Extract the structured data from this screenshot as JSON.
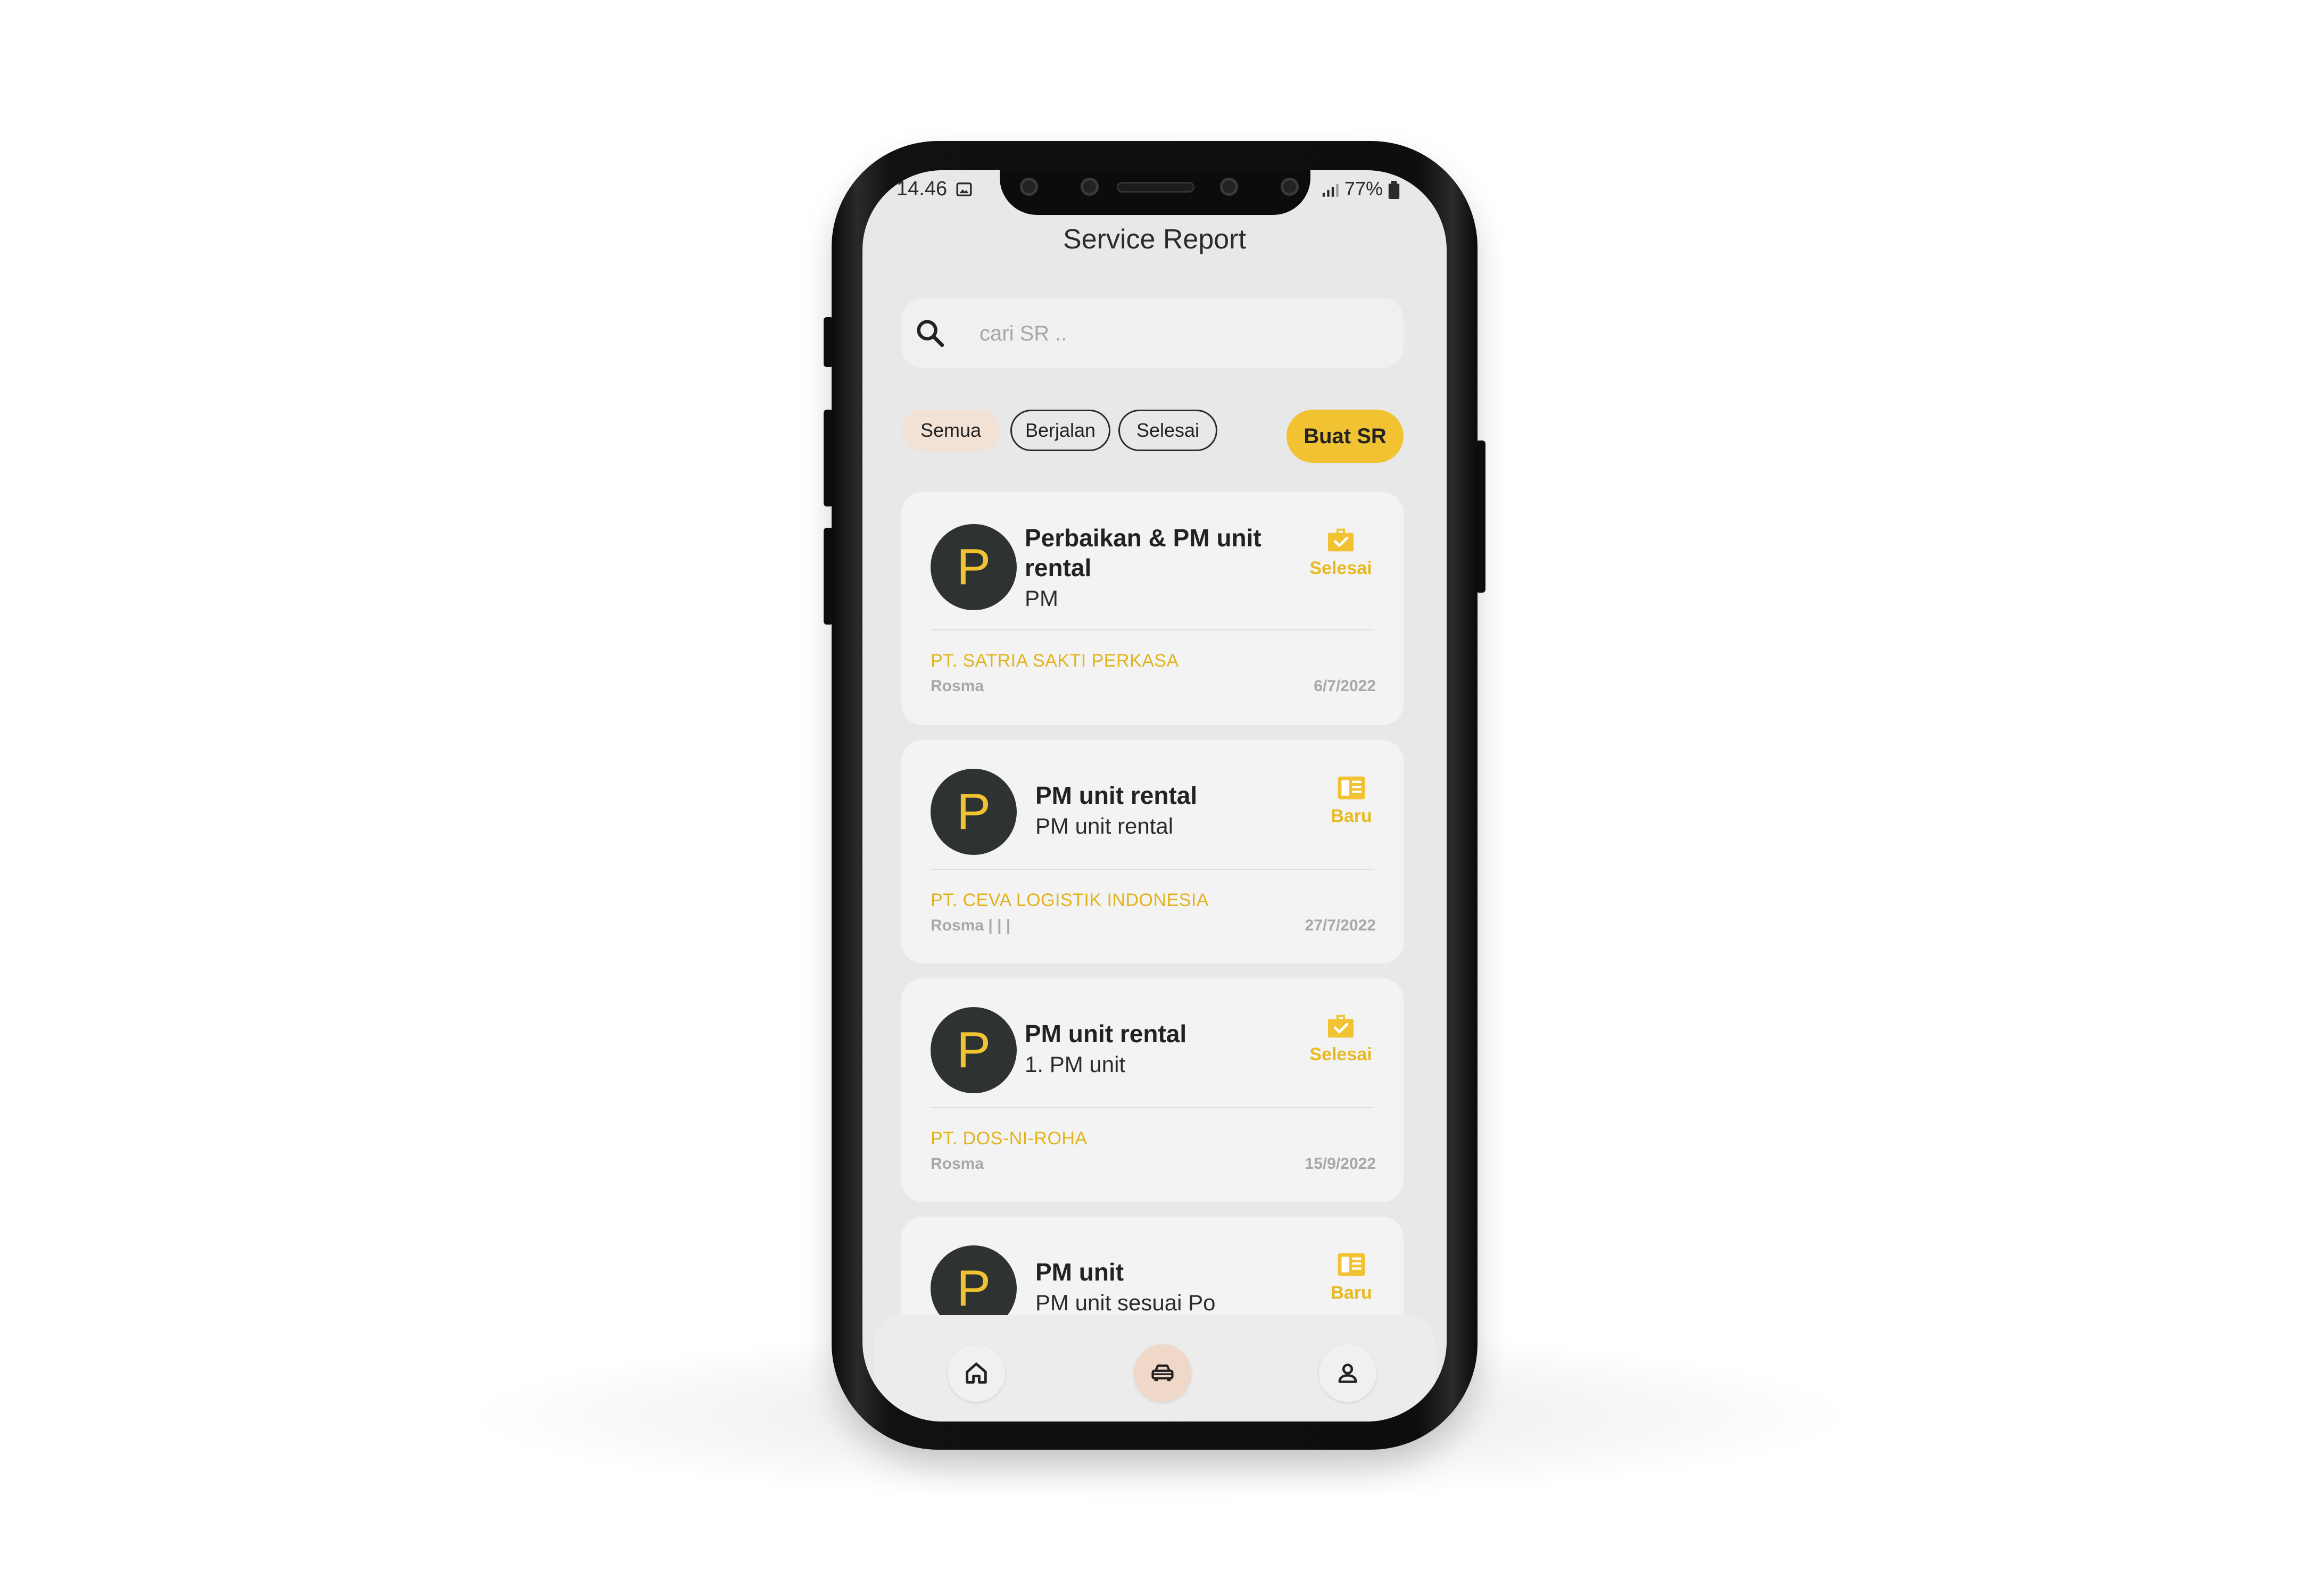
{
  "status_bar": {
    "time": "14.46",
    "battery": "77%"
  },
  "header": {
    "title": "Service Report"
  },
  "search": {
    "placeholder": "cari SR .."
  },
  "filters": {
    "all": "Semua",
    "ongoing": "Berjalan",
    "done": "Selesai",
    "selected": "Semua"
  },
  "actions": {
    "create": "Buat SR"
  },
  "reports": [
    {
      "avatar": "P",
      "title": "Perbaikan & PM unit rental",
      "subtitle": "PM",
      "status": "Selesai",
      "status_icon": "briefcase-check-icon",
      "company": "PT. SATRIA SAKTI PERKASA",
      "person": "Rosma",
      "date": "6/7/2022"
    },
    {
      "avatar": "P",
      "title": "PM unit rental",
      "subtitle": "PM unit rental",
      "status": "Baru",
      "status_icon": "newspaper-icon",
      "company": "PT. CEVA LOGISTIK INDONESIA",
      "person": "Rosma | | |",
      "date": "27/7/2022"
    },
    {
      "avatar": "P",
      "title": "PM unit rental",
      "subtitle": "1. PM unit",
      "status": "Selesai",
      "status_icon": "briefcase-check-icon",
      "company": "PT. DOS-NI-ROHA",
      "person": "Rosma",
      "date": "15/9/2022"
    },
    {
      "avatar": "P",
      "title": "PM unit",
      "subtitle": "PM unit sesuai Po",
      "status": "Baru",
      "status_icon": "newspaper-icon"
    }
  ],
  "nav": {
    "items": [
      "home-icon",
      "vehicle-icon",
      "profile-icon"
    ],
    "active": "vehicle-icon"
  },
  "colors": {
    "accent": "#F1C232",
    "status_text": "#E8B920",
    "avatar_bg": "#2E3332",
    "chip_active_bg": "#F2E2D6",
    "screen_bg": "#E8E8E8",
    "card_bg": "#F3F3F3"
  }
}
